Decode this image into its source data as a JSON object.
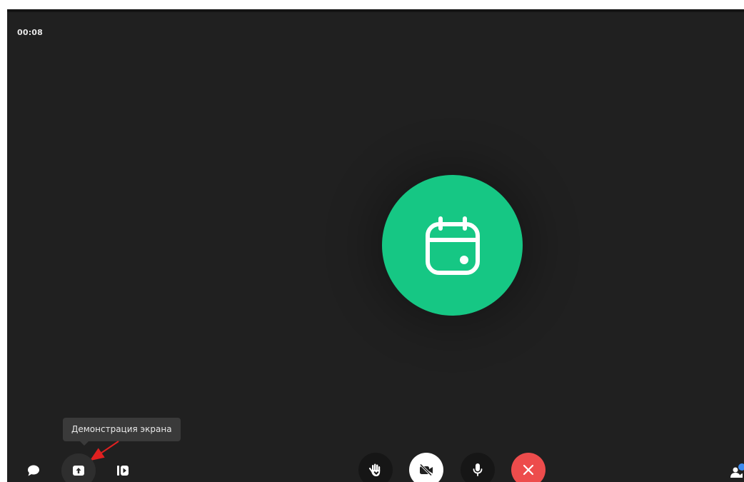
{
  "call": {
    "timer": "00:08"
  },
  "avatar": {
    "icon": "calendar-icon",
    "color": "#16c784"
  },
  "tooltip": {
    "text": "Демонстрация экрана"
  },
  "controls": {
    "left": [
      {
        "icon": "chat-icon"
      },
      {
        "icon": "screen-share-icon"
      },
      {
        "icon": "record-icon"
      }
    ],
    "center": [
      {
        "icon": "raise-hand-icon"
      },
      {
        "icon": "camera-off-icon"
      },
      {
        "icon": "microphone-icon"
      },
      {
        "icon": "hang-up-icon",
        "color": "#ed4c4c"
      }
    ],
    "right": [
      {
        "icon": "participants-icon",
        "badge_color": "#3d8bf2"
      }
    ]
  },
  "annotation": {
    "arrow_color": "#e02020"
  }
}
